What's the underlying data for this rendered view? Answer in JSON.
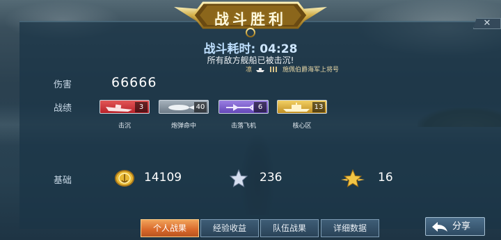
{
  "header": {
    "title": "战斗胜利",
    "close_symbol": "✕"
  },
  "summary": {
    "time_label": "战斗耗时:",
    "time_value": "04:28",
    "result_message": "所有敌方舰船已被击沉!",
    "player_name": "凛",
    "player_rank": "施佩伯爵海军上将号"
  },
  "stats": {
    "damage_label": "伤害",
    "damage_value": "66666",
    "record_label": "战绩",
    "badges": [
      {
        "label": "击沉",
        "count": "3",
        "color": "#d63a3f",
        "icon": "sunk-ship-icon"
      },
      {
        "label": "炮弹命中",
        "count": "40",
        "color": "#8b97a2",
        "icon": "shell-hit-icon"
      },
      {
        "label": "击落飞机",
        "count": "6",
        "color": "#7a5fcc",
        "icon": "plane-down-icon"
      },
      {
        "label": "核心区",
        "count": "13",
        "color": "#dcae3c",
        "icon": "citadel-icon"
      }
    ],
    "base_label": "基础",
    "base_items": [
      {
        "icon": "gold-coin-icon",
        "value": "14109"
      },
      {
        "icon": "silver-star-icon",
        "value": "236"
      },
      {
        "icon": "gold-star-wings-icon",
        "value": "16"
      }
    ]
  },
  "tabs": [
    {
      "label": "个人战果",
      "active": true
    },
    {
      "label": "经验收益",
      "active": false
    },
    {
      "label": "队伍战果",
      "active": false
    },
    {
      "label": "详细数据",
      "active": false
    }
  ],
  "share_button": {
    "label": "分享",
    "icon": "back-arrow-icon"
  },
  "colors": {
    "accent_orange": "#e07a34",
    "title_gold": "#d9b34a",
    "panel": "#1a3446"
  }
}
